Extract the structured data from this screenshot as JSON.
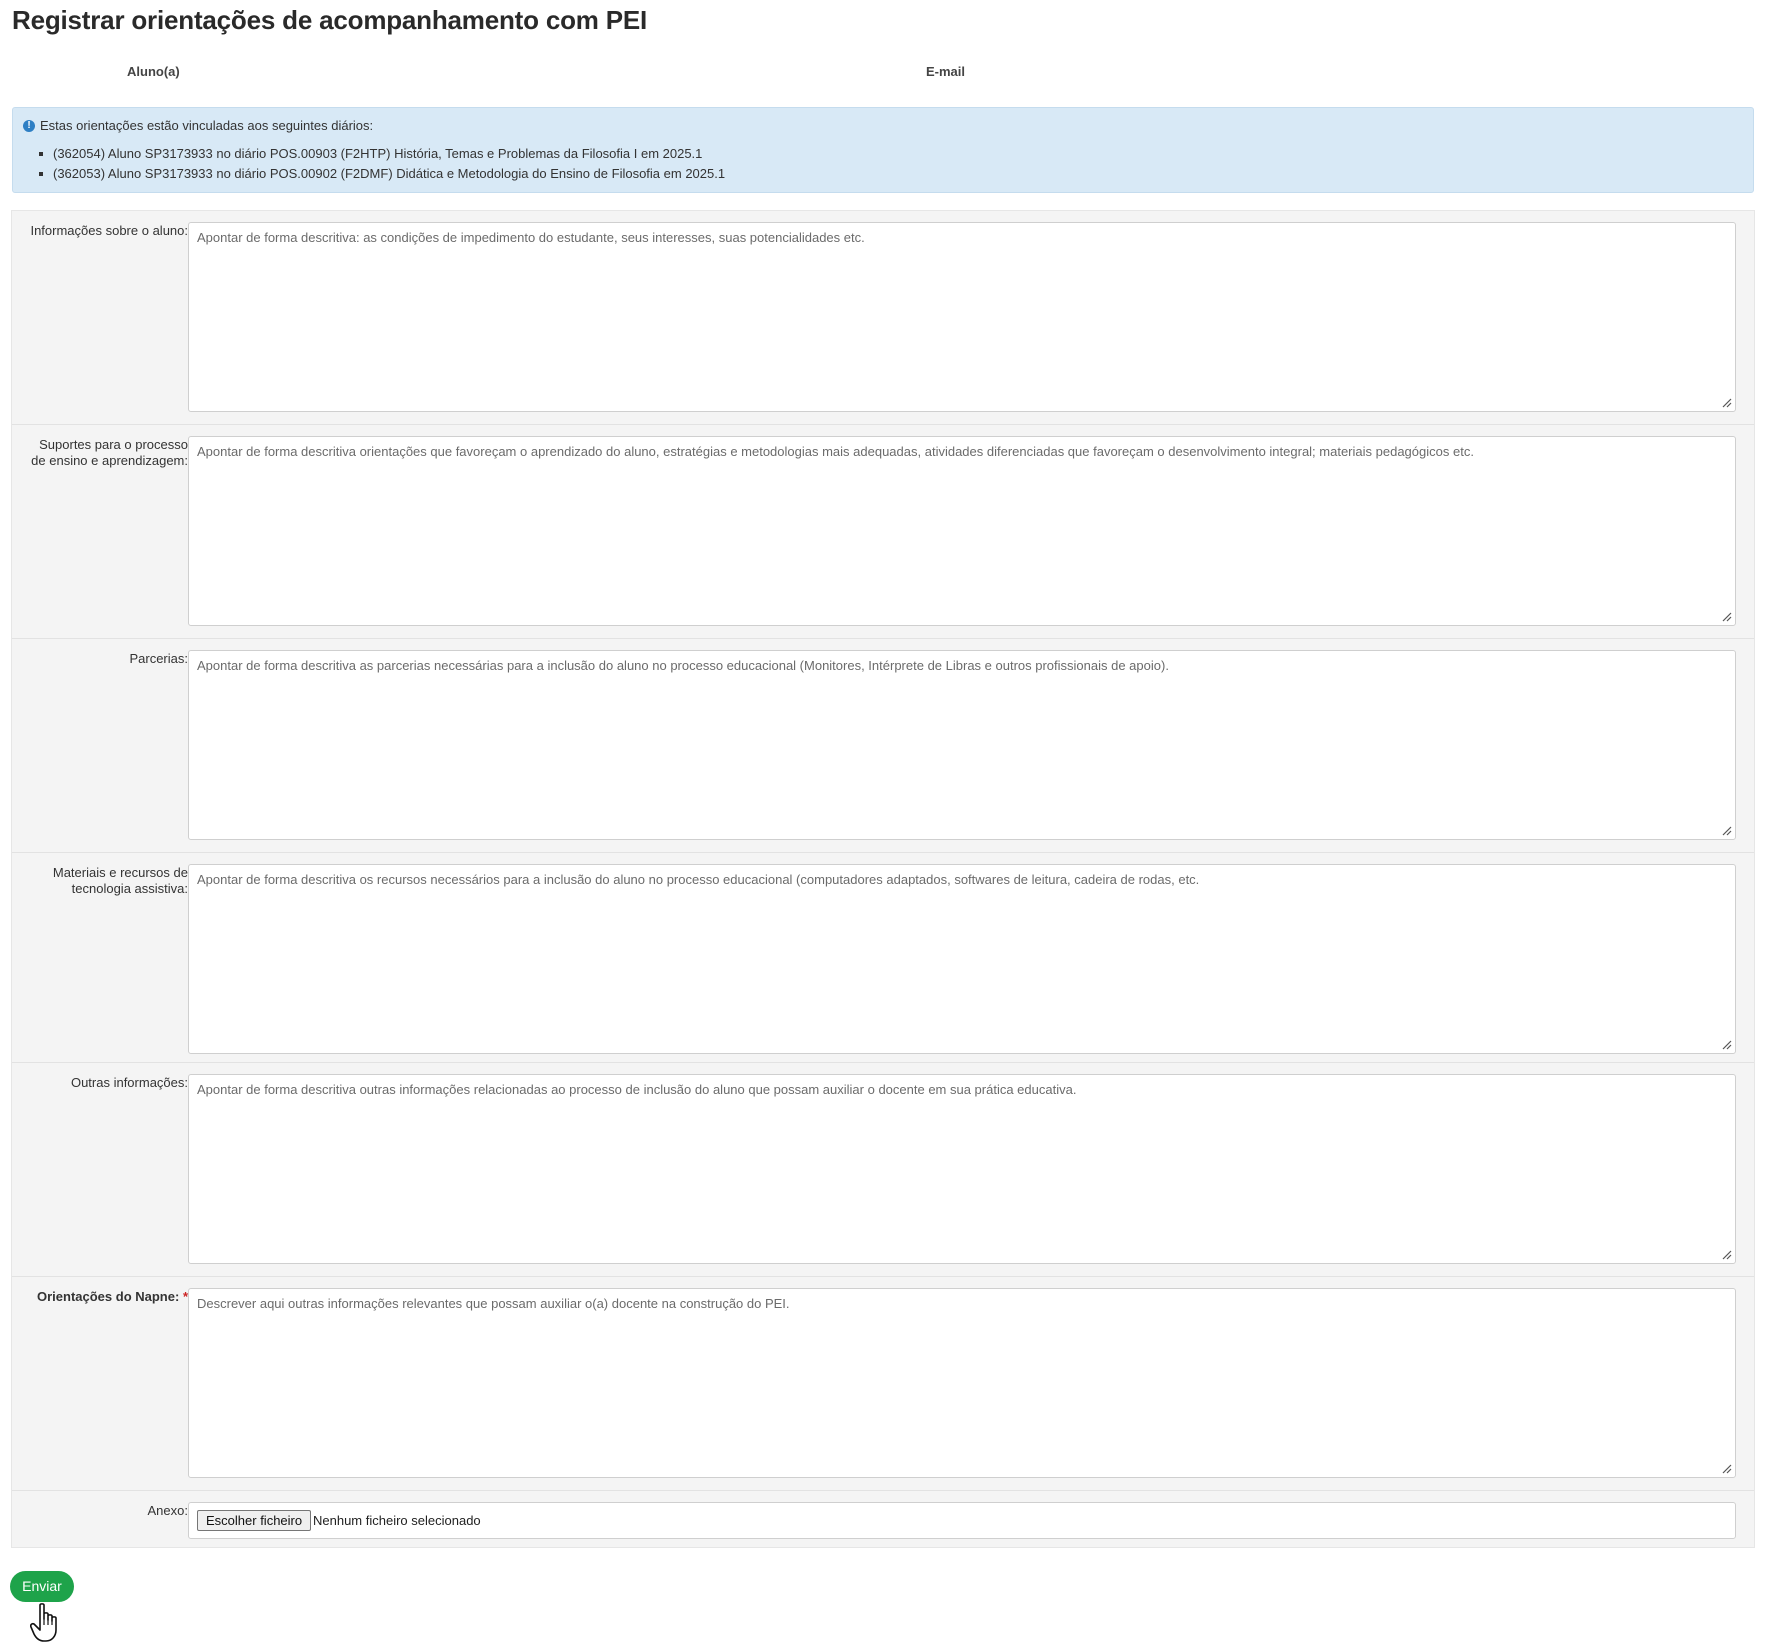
{
  "page": {
    "title": "Registrar orientações de acompanhamento com PEI"
  },
  "student_table": {
    "headers": [
      "Aluno(a)",
      "E-mail"
    ]
  },
  "info_box": {
    "intro": "Estas orientações estão vinculadas aos seguintes diários:",
    "items": [
      "(362054) Aluno SP3173933 no diário POS.00903 (F2HTP) História, Temas e Problemas da Filosofia I em 2025.1",
      "(362053) Aluno SP3173933 no diário POS.00902 (F2DMF) Didática e Metodologia do Ensino de Filosofia em 2025.1"
    ]
  },
  "form": {
    "fields": [
      {
        "label": "Informações sobre o aluno:",
        "placeholder": "Apontar de forma descritiva: as condições de impedimento do estudante, seus interesses, suas potencialidades etc.",
        "value": "",
        "required": false
      },
      {
        "label": "Suportes para o processo de ensino e aprendizagem:",
        "placeholder": "Apontar de forma descritiva orientações que favoreçam o aprendizado do aluno, estratégias e metodologias mais adequadas, atividades diferenciadas que favoreçam o desenvolvimento integral; materiais pedagógicos etc.",
        "value": "",
        "required": false
      },
      {
        "label": "Parcerias:",
        "placeholder": "Apontar de forma descritiva as parcerias necessárias para a inclusão do aluno no processo educacional (Monitores, Intérprete de Libras e outros profissionais de apoio).",
        "value": "",
        "required": false
      },
      {
        "label": "Materiais e recursos de tecnologia assistiva:",
        "placeholder": "Apontar de forma descritiva os recursos necessários para a inclusão do aluno no processo educacional (computadores adaptados, softwares de leitura, cadeira de rodas, etc.",
        "value": "",
        "required": false
      },
      {
        "label": "Outras informações:",
        "placeholder": "Apontar de forma descritiva outras informações relacionadas ao processo de inclusão do aluno que possam auxiliar o docente em sua prática educativa.",
        "value": "",
        "required": false
      },
      {
        "label": "Orientações do Napne:",
        "required_marker": "*",
        "placeholder": "Descrever aqui outras informações relevantes que possam auxiliar o(a) docente na construção do PEI.",
        "value": "",
        "required": true
      }
    ],
    "attachment": {
      "label": "Anexo:",
      "button_label": "Escolher ficheiro",
      "status": "Nenhum ficheiro selecionado"
    },
    "submit_label": "Enviar"
  },
  "icons": {
    "info": "info-circle-icon",
    "resize": "resize-grip-icon",
    "cursor": "hand-pointer-cursor-icon"
  },
  "colors": {
    "info_background": "#d8e9f6",
    "info_icon": "#2e7fc4",
    "submit_background": "#1ea34a",
    "required_marker": "#cc2222"
  }
}
